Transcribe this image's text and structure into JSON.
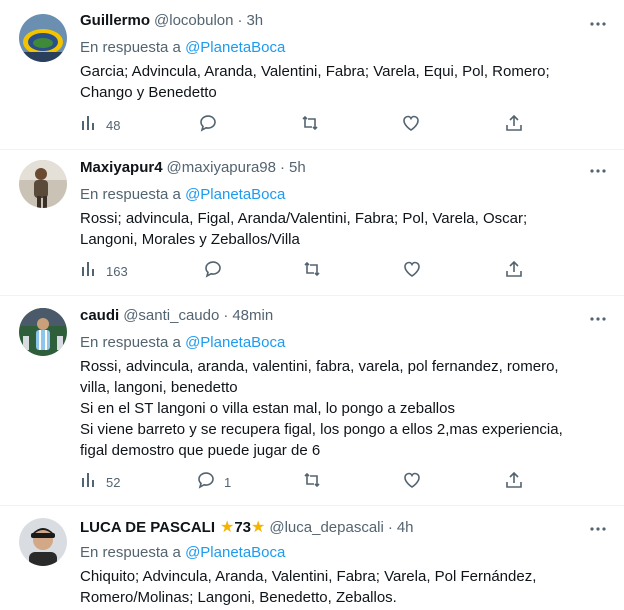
{
  "tweets": [
    {
      "name": "Guillermo",
      "handle": "@locobulon",
      "dot": "·",
      "time": "3h",
      "reply_prefix": "En respuesta a",
      "reply_to": "@PlanetaBoca",
      "lines": [
        "Garcia; Advincula, Aranda, Valentini, Fabra; Varela, Equi, Pol, Romero;",
        "Chango y Benedetto"
      ],
      "views": "48",
      "replies": "",
      "avatar_icon": "stadium-avatar"
    },
    {
      "name": "Maxiyapur4",
      "handle": "@maxiyapura98",
      "dot": "·",
      "time": "5h",
      "reply_prefix": "En respuesta a",
      "reply_to": "@PlanetaBoca",
      "lines": [
        "Rossi; advincula, Figal, Aranda/Valentini, Fabra; Pol, Varela, Oscar;",
        "Langoni, Morales y Zeballos/Villa"
      ],
      "views": "163",
      "replies": "",
      "avatar_icon": "person-avatar"
    },
    {
      "name": "caudi",
      "handle": "@santi_caudo",
      "dot": "·",
      "time": "48min",
      "reply_prefix": "En respuesta a",
      "reply_to": "@PlanetaBoca",
      "lines": [
        "Rossi, advincula, aranda, valentini, fabra, varela, pol fernandez, romero,",
        "villa, langoni, benedetto",
        "Si en el ST langoni o villa estan mal, lo pongo a zeballos",
        "Si viene barreto y se recupera figal, los pongo a ellos 2,mas experiencia,",
        "figal demostro que puede jugar de 6"
      ],
      "views": "52",
      "replies": "1",
      "avatar_icon": "footballer-avatar"
    },
    {
      "name": "LUCA DE PASCALI",
      "name_star": "★",
      "name_number": "73",
      "handle": "@luca_depascali",
      "dot": "·",
      "time": "4h",
      "reply_prefix": "En respuesta a",
      "reply_to": "@PlanetaBoca",
      "lines": [
        "Chiquito; Advincula, Aranda, Valentini, Fabra; Varela, Pol Fernández,",
        "Romero/Molinas; Langoni, Benedetto, Zeballos."
      ],
      "avatar_icon": "cap-person-avatar"
    }
  ],
  "icons": {
    "views": "bar-chart-icon",
    "reply": "speech-bubble-icon",
    "retweet": "retweet-icon",
    "like": "heart-icon",
    "share": "share-icon",
    "more": "more-dots-icon"
  },
  "colors": {
    "text": "#0f1419",
    "secondary": "#536471",
    "link": "#1d9bf0",
    "divider": "#eff3f4"
  }
}
